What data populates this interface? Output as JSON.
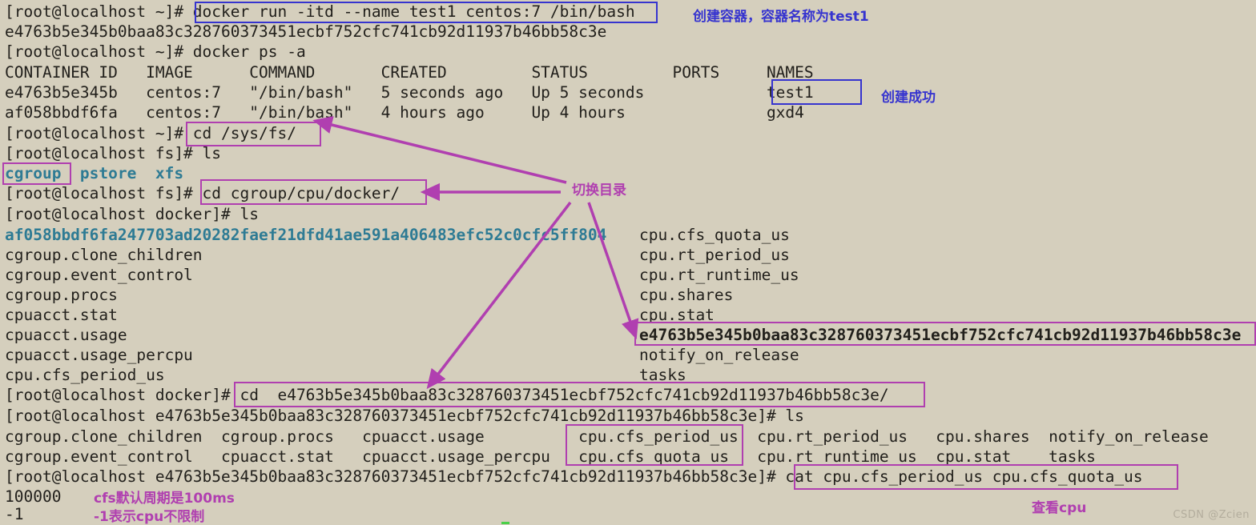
{
  "terminal": {
    "background_color": "#d5cfbd",
    "text_color": "#22201c",
    "directory_color": "#2e7b94",
    "lines": [
      {
        "id": "l1",
        "text": "[root@localhost ~]# docker run -itd --name test1 centos:7 /bin/bash"
      },
      {
        "id": "l2",
        "text": "e4763b5e345b0baa83c328760373451ecbf752cfc741cb92d11937b46bb58c3e"
      },
      {
        "id": "l3",
        "text": "[root@localhost ~]# docker ps -a"
      },
      {
        "id": "l4",
        "text": "CONTAINER ID   IMAGE      COMMAND       CREATED         STATUS         PORTS     NAMES"
      },
      {
        "id": "l5",
        "text": "e4763b5e345b   centos:7   \"/bin/bash\"   5 seconds ago   Up 5 seconds             test1"
      },
      {
        "id": "l6",
        "text": "af058bbdf6fa   centos:7   \"/bin/bash\"   4 hours ago     Up 4 hours               gxd4"
      },
      {
        "id": "l7",
        "text": "[root@localhost ~]# cd /sys/fs/"
      },
      {
        "id": "l8",
        "text": "[root@localhost fs]# ls"
      },
      {
        "id": "l9",
        "text": "cgroup  pstore  xfs"
      },
      {
        "id": "l10",
        "text": "[root@localhost fs]# cd cgroup/cpu/docker/"
      },
      {
        "id": "l11",
        "text": "[root@localhost docker]# ls"
      },
      {
        "id": "l12",
        "text": "af058bbdf6fa247703ad20282faef21dfd41ae591a406483efc52c0cfc5ff804"
      },
      {
        "id": "l13",
        "text": "cgroup.clone_children"
      },
      {
        "id": "l14",
        "text": "cgroup.event_control"
      },
      {
        "id": "l15",
        "text": "cgroup.procs"
      },
      {
        "id": "l16",
        "text": "cpuacct.stat"
      },
      {
        "id": "l17",
        "text": "cpuacct.usage"
      },
      {
        "id": "l18",
        "text": "cpuacct.usage_percpu"
      },
      {
        "id": "l19",
        "text": "cpu.cfs_period_us"
      },
      {
        "id": "l20",
        "text": "cpu.cfs_quota_us"
      },
      {
        "id": "l21",
        "text": "cpu.rt_period_us"
      },
      {
        "id": "l22",
        "text": "cpu.rt_runtime_us"
      },
      {
        "id": "l23",
        "text": "cpu.shares"
      },
      {
        "id": "l24",
        "text": "cpu.stat"
      },
      {
        "id": "l25",
        "text": "e4763b5e345b0baa83c328760373451ecbf752cfc741cb92d11937b46bb58c3e"
      },
      {
        "id": "l26",
        "text": "notify_on_release"
      },
      {
        "id": "l27",
        "text": "tasks"
      },
      {
        "id": "l28",
        "text": "[root@localhost docker]# cd  e4763b5e345b0baa83c328760373451ecbf752cfc741cb92d11937b46bb58c3e/"
      },
      {
        "id": "l29",
        "text": "[root@localhost e4763b5e345b0baa83c328760373451ecbf752cfc741cb92d11937b46bb58c3e]# ls"
      },
      {
        "id": "l30",
        "text": "cgroup.clone_children  cgroup.procs   cpuacct.usage          cpu.cfs_period_us  cpu.rt_period_us   cpu.shares  notify_on_release"
      },
      {
        "id": "l31",
        "text": "cgroup.event_control   cpuacct.stat   cpuacct.usage_percpu   cpu.cfs_quota_us   cpu.rt_runtime_us  cpu.stat    tasks"
      },
      {
        "id": "l32",
        "text": "[root@localhost e4763b5e345b0baa83c328760373451ecbf752cfc741cb92d11937b46bb58c3e]# cat cpu.cfs_period_us cpu.cfs_quota_us"
      },
      {
        "id": "l33",
        "text": "100000"
      },
      {
        "id": "l34",
        "text": "-1"
      }
    ]
  },
  "annotations": {
    "color_purple": "#b03fb0",
    "color_blue": "#3634cf",
    "labels": [
      {
        "id": "a1",
        "text": "创建容器，容器名称为test1",
        "color": "blue"
      },
      {
        "id": "a2",
        "text": "创建成功",
        "color": "blue"
      },
      {
        "id": "a3",
        "text": "切换目录",
        "color": "purple"
      },
      {
        "id": "a4",
        "text": "cfs默认周期是100ms",
        "color": "purple"
      },
      {
        "id": "a5",
        "text": "-1表示cpu不限制",
        "color": "purple"
      },
      {
        "id": "a6",
        "text": "查看cpu",
        "color": "purple"
      }
    ],
    "highlight_boxes": [
      {
        "id": "b1",
        "target": "docker run -itd --name test1 centos:7 /bin/bash",
        "color": "blue"
      },
      {
        "id": "b2",
        "target": "test1",
        "color": "blue"
      },
      {
        "id": "b3",
        "target": "cd /sys/fs/",
        "color": "purple"
      },
      {
        "id": "b4",
        "target": "cgroup",
        "color": "purple"
      },
      {
        "id": "b5",
        "target": "cd cgroup/cpu/docker/",
        "color": "purple"
      },
      {
        "id": "b6",
        "target": "e4763b5e345b0baa83c328760373451ecbf752cfc741cb92d11937b46bb58c3e",
        "color": "purple"
      },
      {
        "id": "b7",
        "target": "cd  e4763b5e345b0baa83c328760373451ecbf752cfc741cb92d11937b46bb58c3e/",
        "color": "purple"
      },
      {
        "id": "b8",
        "target": "cpu.cfs_period_us / cpu.cfs_quota_us",
        "color": "purple"
      },
      {
        "id": "b9",
        "target": "cat cpu.cfs_period_us cpu.cfs_quota_us",
        "color": "purple"
      }
    ]
  },
  "watermark": {
    "text": "CSDN @Zcien"
  }
}
